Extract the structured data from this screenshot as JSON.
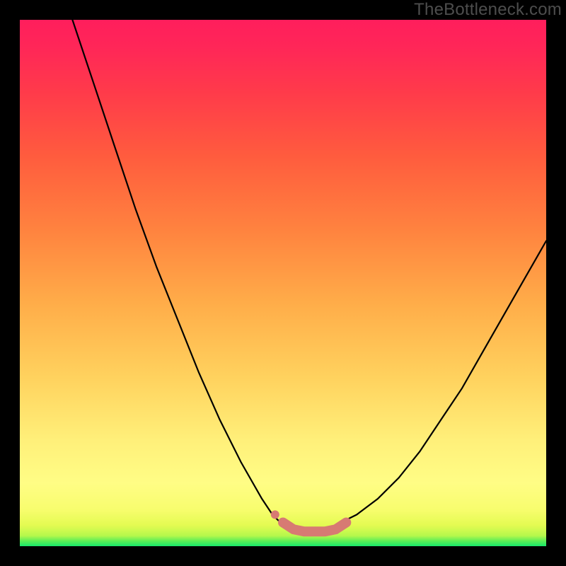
{
  "watermark": "TheBottleneck.com",
  "gradient_colors": {
    "bottom": "#17e86b",
    "mid_low": "#fffd85",
    "mid": "#ffad49",
    "mid_high": "#ff5c3e",
    "top": "#ff1e5c"
  },
  "chart_data": {
    "type": "line",
    "title": "",
    "xlabel": "",
    "ylabel": "",
    "xlim": [
      0,
      100
    ],
    "ylim": [
      0,
      100
    ],
    "series": [
      {
        "name": "left-curve",
        "x": [
          10,
          14,
          18,
          22,
          26,
          30,
          34,
          38,
          42,
          46,
          48,
          50,
          52
        ],
        "values": [
          100,
          88,
          76,
          64,
          53,
          43,
          33,
          24,
          16,
          9,
          6,
          4,
          3
        ]
      },
      {
        "name": "right-curve",
        "x": [
          58,
          60,
          64,
          68,
          72,
          76,
          80,
          84,
          88,
          92,
          96,
          100
        ],
        "values": [
          3,
          4,
          6,
          9,
          13,
          18,
          24,
          30,
          37,
          44,
          51,
          58
        ]
      },
      {
        "name": "marker-bottom",
        "style": "thick-pink",
        "x": [
          50,
          52,
          54,
          56,
          58,
          60,
          62
        ],
        "values": [
          4.5,
          3.2,
          2.8,
          2.8,
          2.8,
          3.2,
          4.5
        ]
      },
      {
        "name": "marker-dot",
        "style": "pink-dot",
        "x": [
          48.5
        ],
        "values": [
          6
        ]
      }
    ]
  }
}
